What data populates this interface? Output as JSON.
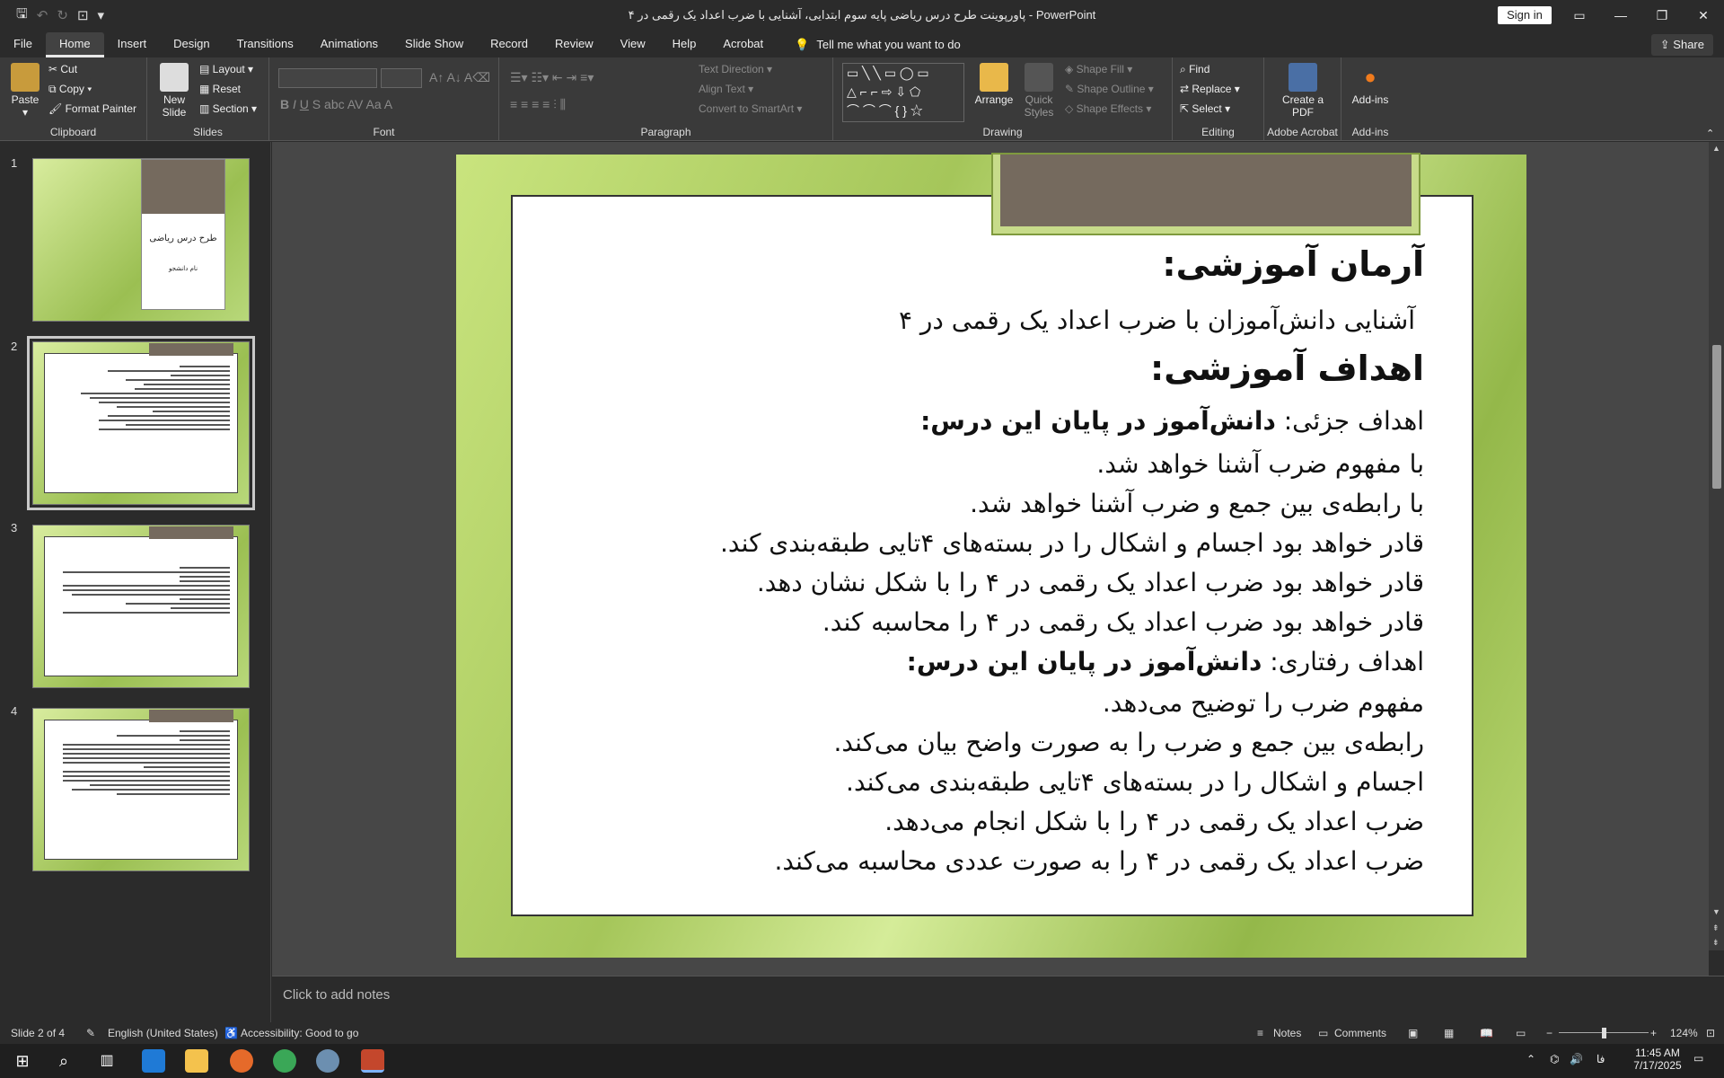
{
  "titlebar": {
    "doc_title": "پاورپوینت طرح درس ریاضی پایه سوم ابتدایی، آشنایی با ضرب اعداد یک رقمی در ۴  -  PowerPoint",
    "sign_in": "Sign in"
  },
  "tabs": [
    "File",
    "Home",
    "Insert",
    "Design",
    "Transitions",
    "Animations",
    "Slide Show",
    "Record",
    "Review",
    "View",
    "Help",
    "Acrobat"
  ],
  "tell_me": "Tell me what you want to do",
  "share": "Share",
  "ribbon": {
    "clipboard": {
      "paste": "Paste",
      "cut": "Cut",
      "copy": "Copy",
      "format_painter": "Format Painter",
      "label": "Clipboard"
    },
    "slides": {
      "new_slide": "New Slide",
      "layout": "Layout",
      "reset": "Reset",
      "section": "Section",
      "label": "Slides"
    },
    "font": {
      "label": "Font"
    },
    "paragraph": {
      "text_direction": "Text Direction",
      "align_text": "Align Text",
      "convert": "Convert to SmartArt",
      "label": "Paragraph"
    },
    "drawing": {
      "arrange": "Arrange",
      "quick_styles": "Quick Styles",
      "shape_fill": "Shape Fill",
      "shape_outline": "Shape Outline",
      "shape_effects": "Shape Effects",
      "label": "Drawing"
    },
    "editing": {
      "find": "Find",
      "replace": "Replace",
      "select": "Select",
      "label": "Editing"
    },
    "acrobat": {
      "create_pdf": "Create a PDF",
      "label": "Adobe Acrobat"
    },
    "addins": {
      "addins": "Add-ins",
      "label": "Add-ins"
    }
  },
  "thumbnails": [
    {
      "num": "1",
      "title": "طرح درس ریاضی",
      "sub": "نام دانشجو"
    },
    {
      "num": "2"
    },
    {
      "num": "3"
    },
    {
      "num": "4"
    }
  ],
  "slide": {
    "h_goal": "آرمان آموزشی:",
    "goal_text": "آشنایی دانش‌آموزان با ضرب اعداد یک رقمی در ۴",
    "h_objectives": "اهداف آموزشی:",
    "partial_prefix": "اهداف جزئی: ",
    "partial_bold": "دانش‌آموز در پایان این درس:",
    "partial_items": [
      "با مفهوم ضرب آشنا خواهد شد.",
      "با رابطه‌ی بین جمع و ضرب آشنا خواهد شد.",
      "قادر خواهد بود اجسام و اشکال را در بسته‌های ۴تایی طبقه‌بندی کند.",
      "قادر خواهد بود ضرب اعداد یک رقمی در ۴ را با شکل نشان دهد.",
      "قادر خواهد بود ضرب اعداد یک رقمی در ۴ را محاسبه کند."
    ],
    "behav_prefix": "اهداف رفتاری: ",
    "behav_bold": "دانش‌آموز در پایان این درس:",
    "behav_items": [
      "مفهوم ضرب را توضیح می‌دهد.",
      "رابطه‌ی بین جمع و ضرب را به صورت واضح بیان می‌کند.",
      "اجسام و اشکال را در بسته‌های ۴تایی طبقه‌بندی می‌کند.",
      "ضرب اعداد یک رقمی در ۴ را با شکل انجام می‌دهد.",
      "ضرب اعداد یک رقمی در ۴ را به صورت عددی محاسبه می‌کند."
    ]
  },
  "notes_placeholder": "Click to add notes",
  "status": {
    "slide_of": "Slide 2 of 4",
    "language": "English (United States)",
    "accessibility": "Accessibility: Good to go",
    "notes": "Notes",
    "comments": "Comments",
    "zoom": "124%"
  },
  "taskbar": {
    "lang": "فا",
    "time": "11:45 AM",
    "date": "7/17/2025"
  }
}
